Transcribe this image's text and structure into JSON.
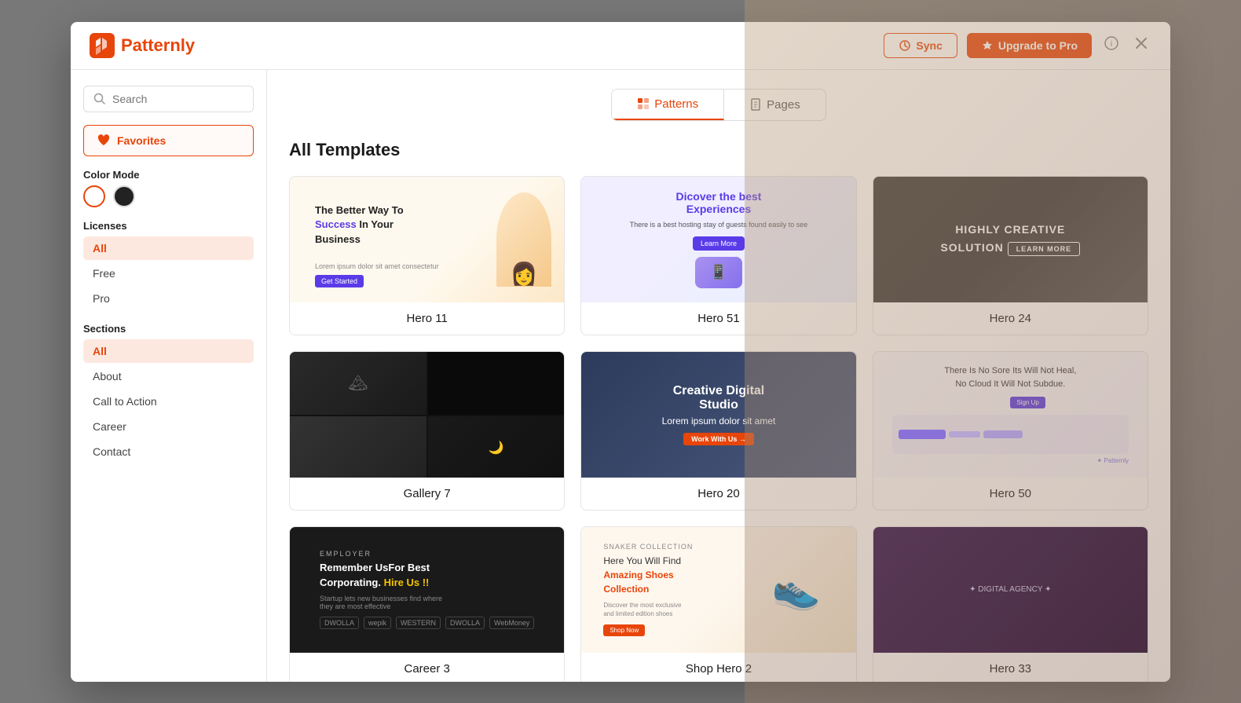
{
  "header": {
    "logo_text": "Patternly",
    "sync_label": "Sync",
    "upgrade_label": "Upgrade to Pro"
  },
  "sidebar": {
    "search_placeholder": "Search",
    "favorites_label": "Favorites",
    "color_mode_label": "Color Mode",
    "licenses_label": "Licenses",
    "license_items": [
      {
        "label": "All",
        "active": true
      },
      {
        "label": "Free",
        "active": false
      },
      {
        "label": "Pro",
        "active": false
      }
    ],
    "sections_label": "Sections",
    "section_items": [
      {
        "label": "All",
        "active": true
      },
      {
        "label": "About",
        "active": false
      },
      {
        "label": "Call to Action",
        "active": false
      },
      {
        "label": "Career",
        "active": false
      },
      {
        "label": "Contact",
        "active": false
      }
    ]
  },
  "tabs": [
    {
      "label": "Patterns",
      "active": true
    },
    {
      "label": "Pages",
      "active": false
    }
  ],
  "main": {
    "heading": "All Templates",
    "templates": [
      {
        "id": "hero11",
        "name": "Hero 11",
        "thumb_type": "hero11"
      },
      {
        "id": "hero51",
        "name": "Hero 51",
        "thumb_type": "hero51"
      },
      {
        "id": "hero24",
        "name": "Hero 24",
        "thumb_type": "hero24"
      },
      {
        "id": "gallery7",
        "name": "Gallery 7",
        "thumb_type": "gallery7"
      },
      {
        "id": "hero20",
        "name": "Hero 20",
        "thumb_type": "hero20"
      },
      {
        "id": "hero50",
        "name": "Hero 50",
        "thumb_type": "hero50"
      },
      {
        "id": "career",
        "name": "Career 3",
        "thumb_type": "career"
      },
      {
        "id": "shoes",
        "name": "Shop Hero 2",
        "thumb_type": "shoes"
      },
      {
        "id": "dark",
        "name": "Hero 33",
        "thumb_type": "dark"
      }
    ]
  }
}
